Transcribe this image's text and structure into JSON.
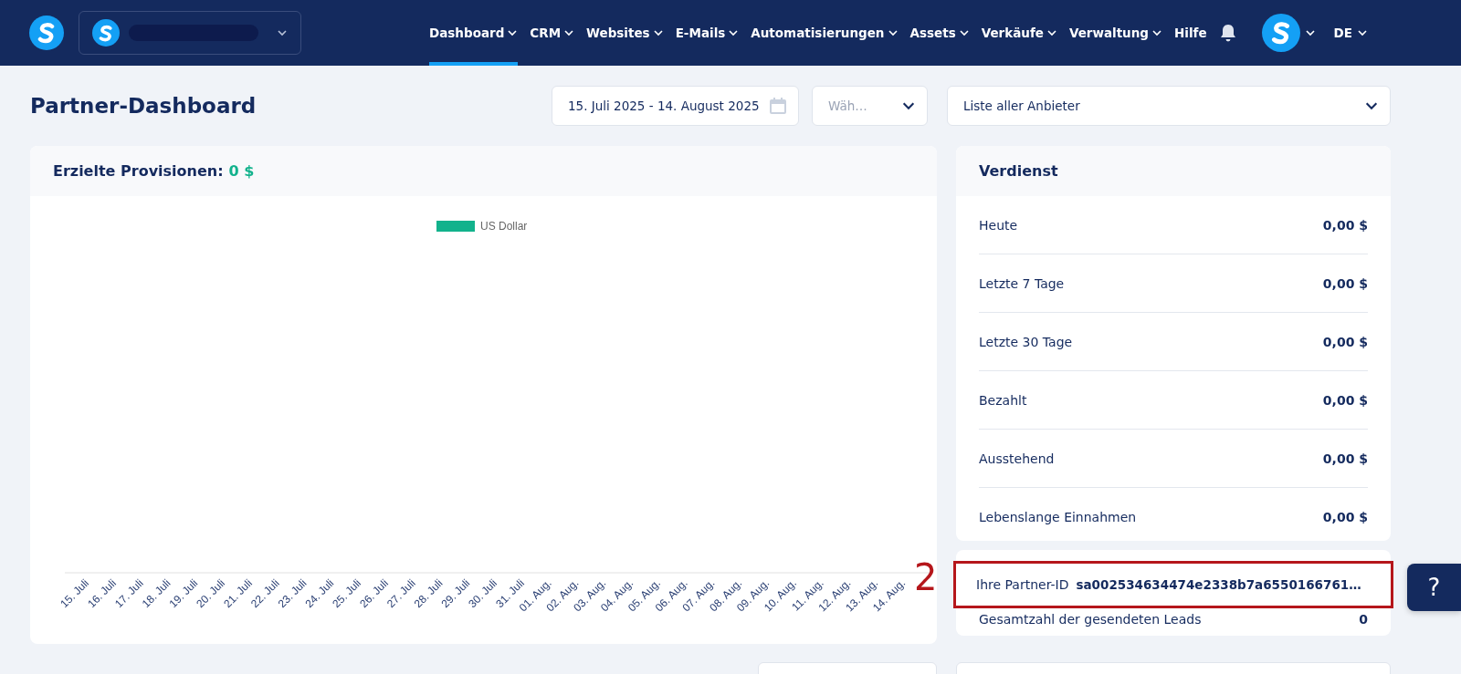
{
  "nav": {
    "items": [
      {
        "label": "Dashboard",
        "dropdown": true,
        "selected": true
      },
      {
        "label": "CRM",
        "dropdown": true,
        "selected": false
      },
      {
        "label": "Websites",
        "dropdown": true,
        "selected": false
      },
      {
        "label": "E-Mails",
        "dropdown": true,
        "selected": false
      },
      {
        "label": "Automatisierungen",
        "dropdown": true,
        "selected": false
      },
      {
        "label": "Assets",
        "dropdown": true,
        "selected": false
      },
      {
        "label": "Verkäufe",
        "dropdown": true,
        "selected": false
      },
      {
        "label": "Verwaltung",
        "dropdown": true,
        "selected": false
      },
      {
        "label": "Hilfe",
        "dropdown": false,
        "selected": false
      }
    ],
    "language": "DE"
  },
  "page_title": "Partner-Dashboard",
  "filters": {
    "date_range": "15. Juli 2025 - 14. August 2025",
    "select_placeholder": "Wäh…",
    "vendor": "Liste aller Anbieter"
  },
  "commissions": {
    "label": "Erzielte Provisionen:",
    "value": "0 $",
    "chart": {
      "legend": {
        "label": "US Dollar",
        "color": "#12b28c"
      },
      "x_labels": [
        "15. Juli",
        "16. Juli",
        "17. Juli",
        "18. Juli",
        "19. Juli",
        "20. Juli",
        "21. Juli",
        "22. Juli",
        "23. Juli",
        "24. Juli",
        "25. Juli",
        "26. Juli",
        "27. Juli",
        "28. Juli",
        "29. Juli",
        "30. Juli",
        "31. Juli",
        "01. Aug.",
        "02. Aug.",
        "03. Aug.",
        "04. Aug.",
        "05. Aug.",
        "06. Aug.",
        "07. Aug.",
        "08. Aug.",
        "09. Aug.",
        "10. Aug.",
        "11. Aug.",
        "12. Aug.",
        "13. Aug.",
        "14. Aug."
      ]
    }
  },
  "earnings": {
    "title": "Verdienst",
    "rows": [
      {
        "label": "Heute",
        "value": "0,00 $"
      },
      {
        "label": "Letzte 7 Tage",
        "value": "0,00 $"
      },
      {
        "label": "Letzte 30 Tage",
        "value": "0,00 $"
      },
      {
        "label": "Bezahlt",
        "value": "0,00 $"
      },
      {
        "label": "Ausstehend",
        "value": "0,00 $"
      },
      {
        "label": "Lebenslange Einnahmen",
        "value": "0,00 $"
      }
    ]
  },
  "partner": {
    "id_label": "Ihre Partner-ID",
    "id_value": "sa002534634474e2338b7a6550166761…",
    "leads_label": "Gesamtzahl der gesendeten Leads",
    "leads_value": "0"
  },
  "annotation": {
    "number": "2",
    "highlighted": true
  },
  "help_button": "?"
}
